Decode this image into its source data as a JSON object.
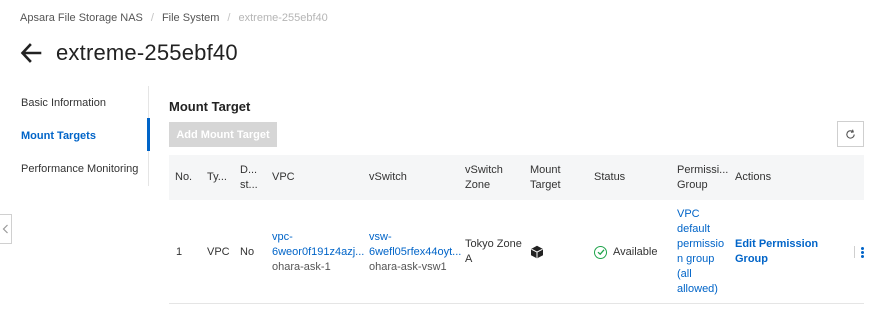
{
  "breadcrumb": {
    "items": [
      "Apsara File Storage NAS",
      "File System"
    ],
    "current": "extreme-255ebf40",
    "separator": "/"
  },
  "header": {
    "title": "extreme-255ebf40",
    "back_icon": "arrow-left-icon"
  },
  "side_nav": {
    "items": [
      {
        "label": "Basic Information",
        "active": false
      },
      {
        "label": "Mount Targets",
        "active": true
      },
      {
        "label": "Performance Monitoring",
        "active": false
      }
    ]
  },
  "main": {
    "section_title": "Mount Target",
    "add_button": "Add Mount Target",
    "refresh_icon": "refresh-icon"
  },
  "table": {
    "headers": {
      "no": "No.",
      "type": [
        "Ty..."
      ],
      "dual_stack": [
        "D...",
        "st..."
      ],
      "vpc": "VPC",
      "vswitch": "vSwitch",
      "vswitch_zone": [
        "vSwitch",
        "Zone"
      ],
      "mount_target": [
        "Mount",
        "Target"
      ],
      "status": "Status",
      "permission_group": [
        "Permissi...",
        "Group"
      ],
      "actions": "Actions"
    },
    "rows": [
      {
        "no": "1",
        "type": "VPC",
        "dual_stack": "No",
        "vpc_id": [
          "vpc-",
          "6weor0f191z4azj..."
        ],
        "vpc_name": "ohara-ask-1",
        "vswitch_id": [
          "vsw-",
          "6wefl05rfex44oyt..."
        ],
        "vswitch_name": "ohara-ask-vsw1",
        "zone": [
          "Tokyo Zone",
          "A"
        ],
        "mount_target_icon": "cube-icon",
        "status": "Available",
        "status_color": "#1ea34a",
        "permission_group": [
          "VPC",
          "default",
          "permissio",
          "n group",
          "(all",
          "allowed)"
        ],
        "action_edit": "Edit Permission Group",
        "action_more_icon": "more-vertical-icon"
      }
    ]
  },
  "colors": {
    "accent": "#0064c8",
    "success": "#1ea34a",
    "disabled_button": "#d6d6d6"
  }
}
